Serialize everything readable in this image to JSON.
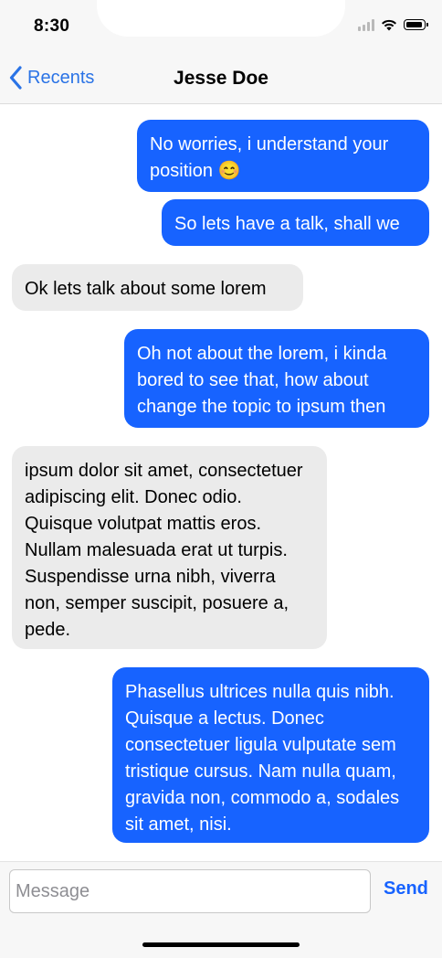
{
  "status_bar": {
    "time": "8:30",
    "icons": [
      "signal-icon",
      "wifi-icon",
      "battery-icon"
    ]
  },
  "nav": {
    "back_label": "Recents",
    "back_icon": "chevron-left-icon",
    "title": "Jesse Doe"
  },
  "colors": {
    "accent": "#2a73e6",
    "sent_bubble": "#1763ff",
    "received_bubble": "#ebebeb",
    "bar_background": "#f7f7f7"
  },
  "messages": [
    {
      "direction": "sent",
      "text": "No worries, i understand your position 😊"
    },
    {
      "direction": "sent",
      "text": "So lets have a talk, shall we"
    },
    {
      "direction": "received",
      "text": "Ok lets talk about some lorem"
    },
    {
      "direction": "sent",
      "text": "Oh not about the lorem, i kinda bored to see that, how about change the topic to ipsum then"
    },
    {
      "direction": "received",
      "text": " ipsum dolor sit amet, consectetuer adipiscing elit. Donec odio. Quisque volutpat mattis eros. Nullam malesuada erat ut turpis. Suspendisse urna nibh, viverra non, semper suscipit, posuere a, pede."
    },
    {
      "direction": "sent",
      "text": "Phasellus ultrices nulla quis nibh. Quisque a lectus. Donec consectetuer ligula vulputate sem tristique cursus. Nam nulla quam, gravida non, commodo a, sodales sit amet, nisi."
    }
  ],
  "composer": {
    "placeholder": "Message",
    "value": "",
    "send_label": "Send"
  }
}
